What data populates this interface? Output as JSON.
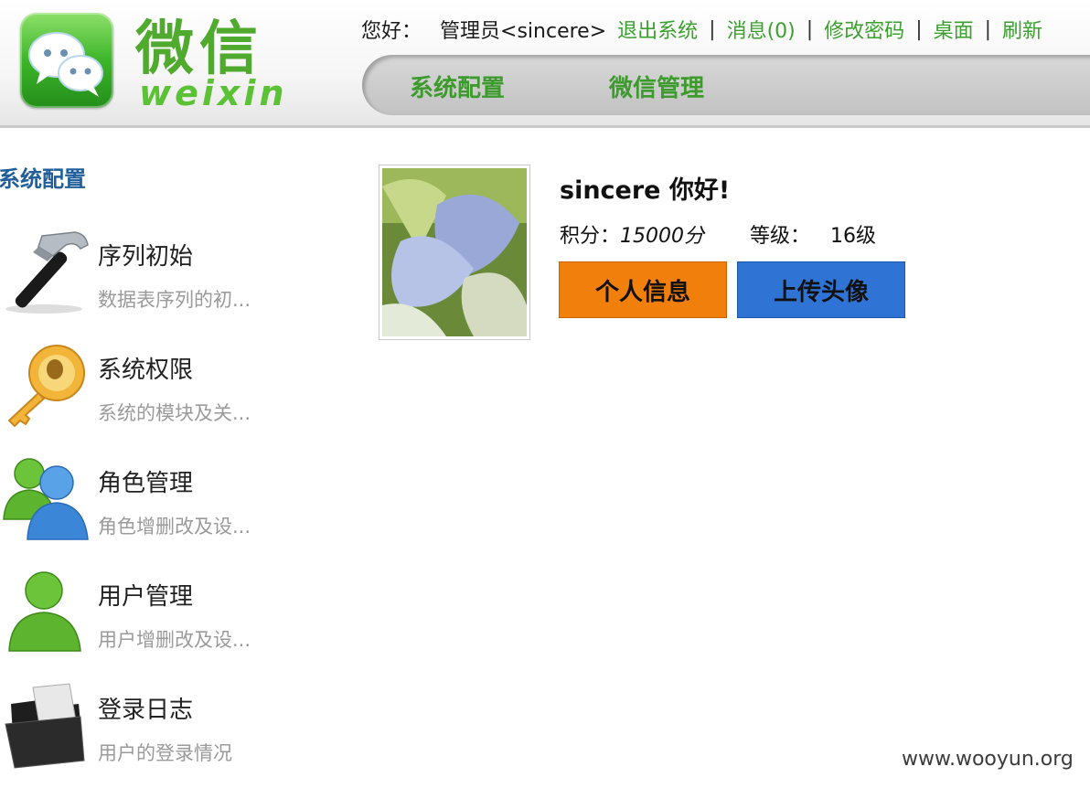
{
  "header": {
    "logo_cn": "微信",
    "logo_en": "weixin",
    "greeting": "您好：",
    "user_label": "管理员<sincere>",
    "links": [
      "退出系统",
      "消息(0)",
      "修改密码",
      "桌面",
      "刷新"
    ],
    "nav": [
      "系统配置",
      "微信管理"
    ]
  },
  "sidebar": {
    "title": "系统配置",
    "items": [
      {
        "label": "序列初始",
        "desc": "数据表序列的初...",
        "icon": "hammer-icon"
      },
      {
        "label": "系统权限",
        "desc": "系统的模块及关...",
        "icon": "key-icon"
      },
      {
        "label": "角色管理",
        "desc": "角色增删改及设...",
        "icon": "users-icon"
      },
      {
        "label": "用户管理",
        "desc": "用户增删改及设...",
        "icon": "user-icon"
      },
      {
        "label": "登录日志",
        "desc": "用户的登录情况",
        "icon": "folder-icon"
      }
    ]
  },
  "profile": {
    "hello": "sincere 你好!",
    "score_label": "积分：",
    "score_value": "15000分",
    "level_label": "等级：",
    "level_value": "16级",
    "btn_info": "个人信息",
    "btn_upload": "上传头像",
    "colors": {
      "info_button": "#f07f0c",
      "upload_button": "#2f74d4",
      "link": "#3aa02e"
    }
  },
  "watermark": "www.wooyun.org"
}
